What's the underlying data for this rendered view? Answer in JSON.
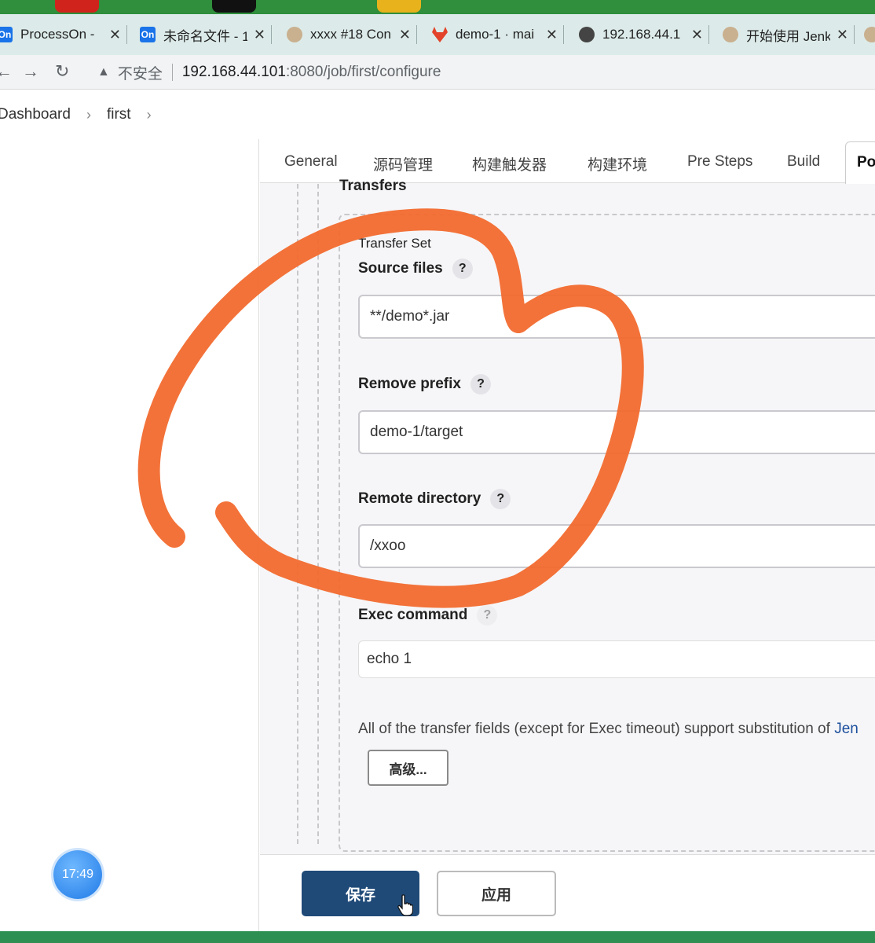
{
  "browser": {
    "tabs": [
      {
        "title": "ProcessOn - ",
        "icon": "processon-icon",
        "fav_text": "On",
        "color": "#1a73e8"
      },
      {
        "title": "未命名文件 - 1",
        "icon": "processon-icon",
        "fav_text": "On",
        "color": "#1a73e8"
      },
      {
        "title": "xxxx #18 Con",
        "icon": "jenkins-icon",
        "fav_text": "",
        "color": "#8a6d4f"
      },
      {
        "title": "demo-1 · mai",
        "icon": "gitlab-icon",
        "fav_text": "",
        "color": "#e2432a"
      },
      {
        "title": "192.168.44.1",
        "icon": "globe-icon",
        "fav_text": "",
        "color": "#444444"
      },
      {
        "title": "开始使用 Jenk",
        "icon": "jenkins-icon",
        "fav_text": "",
        "color": "#8a6d4f"
      }
    ],
    "address": {
      "security_label": "不安全",
      "host": "192.168.44.101",
      "path": ":8080/job/first/configure"
    }
  },
  "breadcrumb": {
    "items": [
      "Dashboard",
      "first"
    ]
  },
  "config_tabs": [
    "General",
    "源码管理",
    "构建触发器",
    "构建环境",
    "Pre Steps",
    "Build",
    "Po"
  ],
  "form": {
    "section_title": "Transfers",
    "transfer_set_title": "Transfer Set",
    "source_files": {
      "label": "Source files",
      "value": "**/demo*.jar"
    },
    "remove_prefix": {
      "label": "Remove prefix",
      "value": "demo-1/target"
    },
    "remote_directory": {
      "label": "Remote directory",
      "value": "/xxoo"
    },
    "exec_command": {
      "label": "Exec command",
      "value": "echo 1"
    },
    "help_glyph": "?",
    "info_text": "All of the transfer fields (except for Exec timeout) support substitution of ",
    "info_link": "Jen",
    "advanced_button": "高级..."
  },
  "actions": {
    "save": "保存",
    "apply": "应用"
  },
  "clock": "17:49",
  "colors": {
    "save_button": "#1f4a78",
    "annotation_stroke": "#f26a2e",
    "tab_bar": "#dcebe9"
  }
}
